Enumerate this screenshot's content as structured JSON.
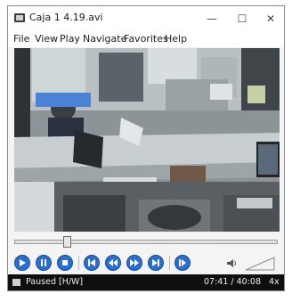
{
  "window": {
    "title": "Caja 1 4.19.avi",
    "controls": {
      "minimize": "—",
      "maximize": "☐",
      "close": "✕"
    }
  },
  "menu": [
    "File",
    "View",
    "Play",
    "Navigate",
    "Favorites",
    "Help"
  ],
  "playback": {
    "position_fraction": 0.19
  },
  "controls": [
    "play-icon",
    "pause-icon",
    "stop-icon",
    "skip-back-icon",
    "rewind-icon",
    "fast-forward-icon",
    "skip-forward-icon",
    "step-frame-icon"
  ],
  "status": {
    "state": "Paused [H/W]",
    "time": "07:41 / 40:08",
    "speed": "4x"
  },
  "colors": {
    "button_blue": "#2a6fd0",
    "status_bg": "#0f0f0f",
    "redaction_blue": "#4a82d6"
  }
}
